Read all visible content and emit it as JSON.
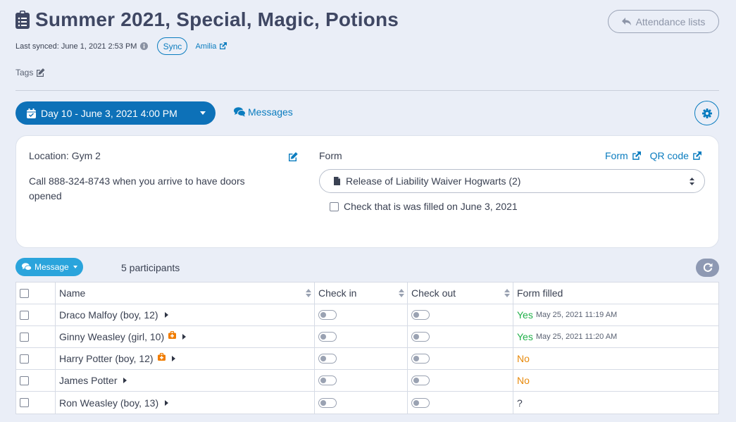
{
  "header": {
    "title": "Summer 2021, Special, Magic, Potions",
    "attendance_label": "Attendance lists",
    "last_synced": "Last synced: June 1, 2021 2:53 PM",
    "sync_label": "Sync",
    "amilia_label": "Amilia",
    "tags_label": "Tags"
  },
  "toolbar": {
    "day_label": "Day 10 - June 3, 2021 4:00 PM",
    "messages_label": "Messages"
  },
  "info": {
    "location_label": "Location: Gym 2",
    "location_note": "Call 888-324-8743 when you arrive to have doors opened",
    "form_label": "Form",
    "form_link": "Form",
    "qr_link": "QR code",
    "form_selected": "Release of Liability Waiver Hogwarts (2)",
    "check_label": "Check that is was filled on June 3, 2021"
  },
  "participants": {
    "message_label": "Message",
    "count_label": "5 participants"
  },
  "table": {
    "headers": [
      "Name",
      "Check in",
      "Check out",
      "Form filled"
    ],
    "rows": [
      {
        "name": "Draco Malfoy (boy, 12)",
        "medical": false,
        "form": "Yes",
        "form_ts": "May 25, 2021 11:19 AM",
        "status": "yes"
      },
      {
        "name": "Ginny Weasley (girl, 10)",
        "medical": true,
        "form": "Yes",
        "form_ts": "May 25, 2021 11:20 AM",
        "status": "yes"
      },
      {
        "name": "Harry Potter (boy, 12)",
        "medical": true,
        "form": "No",
        "form_ts": "",
        "status": "no"
      },
      {
        "name": "James Potter",
        "medical": false,
        "form": "No",
        "form_ts": "",
        "status": "no"
      },
      {
        "name": "Ron Weasley (boy, 13)",
        "medical": false,
        "form": "?",
        "form_ts": "",
        "status": "unknown"
      }
    ]
  },
  "colors": {
    "primary": "#0d71b8",
    "link": "#0a7cbf",
    "yes": "#21b04a",
    "no": "#e88a0c",
    "medical": "#f07c00"
  }
}
